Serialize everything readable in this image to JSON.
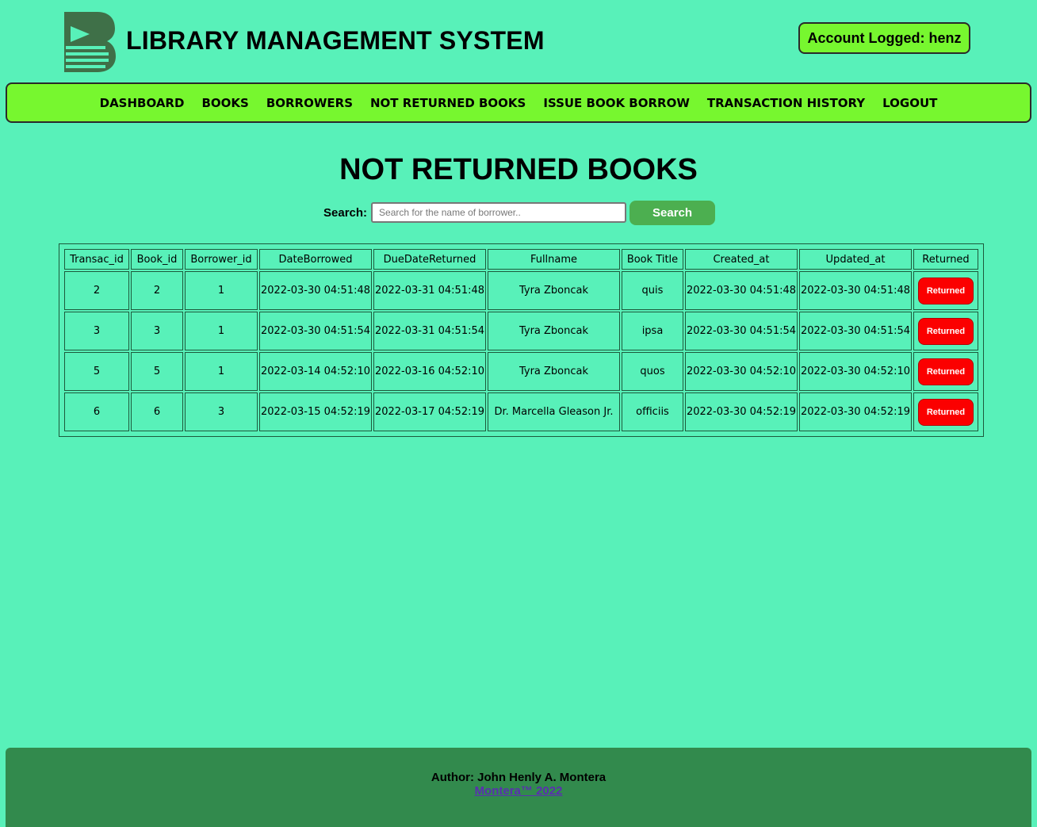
{
  "header": {
    "title": "LIBRARY MANAGEMENT SYSTEM",
    "account_label": "Account Logged: henz",
    "logo_icon": "book-stack-logo-icon"
  },
  "nav": {
    "items": [
      {
        "label": "DASHBOARD"
      },
      {
        "label": "BOOKS"
      },
      {
        "label": "BORROWERS"
      },
      {
        "label": "NOT RETURNED BOOKS"
      },
      {
        "label": "ISSUE BOOK BORROW"
      },
      {
        "label": "TRANSACTION HISTORY"
      },
      {
        "label": "LOGOUT"
      }
    ]
  },
  "main": {
    "title": "NOT RETURNED BOOKS",
    "search": {
      "label": "Search:",
      "placeholder": "Search for the name of borrower..",
      "value": "",
      "button_label": "Search"
    }
  },
  "table": {
    "headers": [
      "Transac_id",
      "Book_id",
      "Borrower_id",
      "DateBorrowed",
      "DueDateReturned",
      "Fullname",
      "Book Title",
      "Created_at",
      "Updated_at",
      "Returned"
    ],
    "rows": [
      {
        "transac_id": "2",
        "book_id": "2",
        "borrower_id": "1",
        "date_borrowed": "2022-03-30 04:51:48",
        "due_date_returned": "2022-03-31 04:51:48",
        "fullname": "Tyra Zboncak",
        "book_title": "quis",
        "created_at": "2022-03-30 04:51:48",
        "updated_at": "2022-03-30 04:51:48",
        "action": "Returned"
      },
      {
        "transac_id": "3",
        "book_id": "3",
        "borrower_id": "1",
        "date_borrowed": "2022-03-30 04:51:54",
        "due_date_returned": "2022-03-31 04:51:54",
        "fullname": "Tyra Zboncak",
        "book_title": "ipsa",
        "created_at": "2022-03-30 04:51:54",
        "updated_at": "2022-03-30 04:51:54",
        "action": "Returned"
      },
      {
        "transac_id": "5",
        "book_id": "5",
        "borrower_id": "1",
        "date_borrowed": "2022-03-14 04:52:10",
        "due_date_returned": "2022-03-16 04:52:10",
        "fullname": "Tyra Zboncak",
        "book_title": "quos",
        "created_at": "2022-03-30 04:52:10",
        "updated_at": "2022-03-30 04:52:10",
        "action": "Returned"
      },
      {
        "transac_id": "6",
        "book_id": "6",
        "borrower_id": "3",
        "date_borrowed": "2022-03-15 04:52:19",
        "due_date_returned": "2022-03-17 04:52:19",
        "fullname": "Dr. Marcella Gleason Jr.",
        "book_title": "officiis",
        "created_at": "2022-03-30 04:52:19",
        "updated_at": "2022-03-30 04:52:19",
        "action": "Returned"
      }
    ]
  },
  "footer": {
    "author": "Author: John Henly A. Montera",
    "link_text": "Montera™ 2022"
  },
  "colors": {
    "page_background": "#58f1b9",
    "nav_background": "#77f72f",
    "search_button": "#4caf50",
    "returned_button": "#fb0000",
    "footer_background": "#328a4d",
    "logo": "#3f7048"
  }
}
